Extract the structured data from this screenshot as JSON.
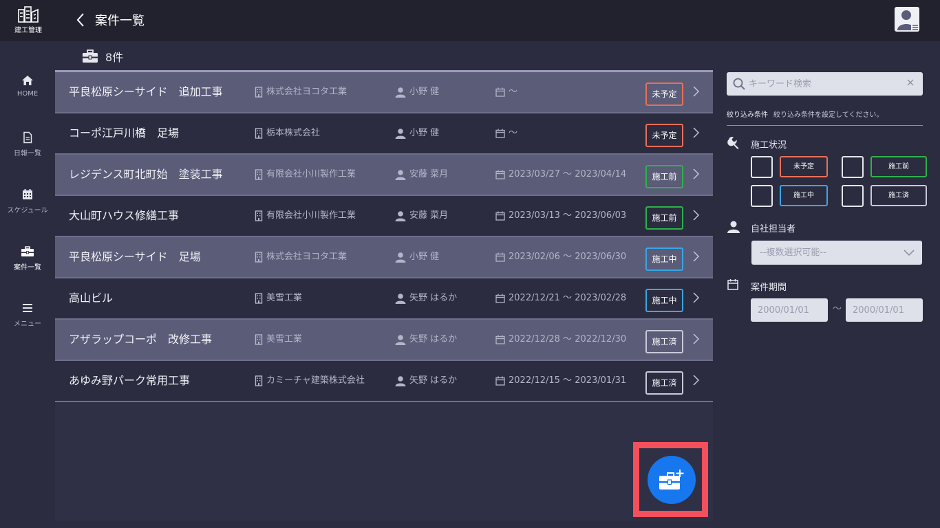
{
  "header": {
    "app_name": "建工管理",
    "title": "案件一覧"
  },
  "sidebar": {
    "items": [
      {
        "label": "HOME",
        "icon": "home-icon",
        "active": false
      },
      {
        "label": "日報一覧",
        "icon": "document-icon",
        "active": false
      },
      {
        "label": "スケジュール",
        "icon": "calendar-icon",
        "active": false
      },
      {
        "label": "案件一覧",
        "icon": "briefcase-icon",
        "active": true
      },
      {
        "label": "メニュー",
        "icon": "menu-icon",
        "active": false
      }
    ]
  },
  "list": {
    "count_text": "8件",
    "rows": [
      {
        "name": "平良松原シーサイド　追加工事",
        "company": "株式会社ヨコタ工業",
        "person": "小野 健",
        "period": "～",
        "status": "未予定"
      },
      {
        "name": "コーポ江戸川橋　足場",
        "company": "栃本株式会社",
        "person": "小野 健",
        "period": "～",
        "status": "未予定"
      },
      {
        "name": "レジデンス町北町始　塗装工事",
        "company": "有限会社小川製作工業",
        "person": "安藤 菜月",
        "period": "2023/03/27 ～ 2023/04/14",
        "status": "施工前"
      },
      {
        "name": "大山町ハウス修繕工事",
        "company": "有限会社小川製作工業",
        "person": "安藤 菜月",
        "period": "2023/03/13 ～ 2023/06/03",
        "status": "施工前"
      },
      {
        "name": "平良松原シーサイド　足場",
        "company": "株式会社ヨコタ工業",
        "person": "小野 健",
        "period": "2023/02/06 ～ 2023/06/30",
        "status": "施工中"
      },
      {
        "name": "高山ビル",
        "company": "美雪工業",
        "person": "矢野 はるか",
        "period": "2022/12/21 ～ 2023/02/28",
        "status": "施工中"
      },
      {
        "name": "アザラップコーポ　改修工事",
        "company": "美雪工業",
        "person": "矢野 はるか",
        "period": "2022/12/28 ～ 2022/12/30",
        "status": "施工済"
      },
      {
        "name": "あゆみ野パーク常用工事",
        "company": "カミーチャ建築株式会社",
        "person": "矢野 はるか",
        "period": "2022/12/15 ～ 2023/01/31",
        "status": "施工済"
      }
    ]
  },
  "filters": {
    "search_placeholder": "キーワード検索",
    "condition_label": "絞り込み条件",
    "condition_hint": "絞り込み条件を設定してください。",
    "status_section": "施工状況",
    "statuses": [
      "未予定",
      "施工前",
      "施工中",
      "施工済"
    ],
    "staff_section": "自社担当者",
    "staff_placeholder": "--複数選択可能--",
    "period_section": "案件期間",
    "date_from_placeholder": "2000/01/01",
    "date_separator": "～",
    "date_to_placeholder": "2000/01/01"
  },
  "colors": {
    "未予定": "#e8705a",
    "施工前": "#2fb24a",
    "施工中": "#39a7e6",
    "施工済": "#c8cadb",
    "fab": "#1677ee",
    "highlight": "#f4505c"
  }
}
